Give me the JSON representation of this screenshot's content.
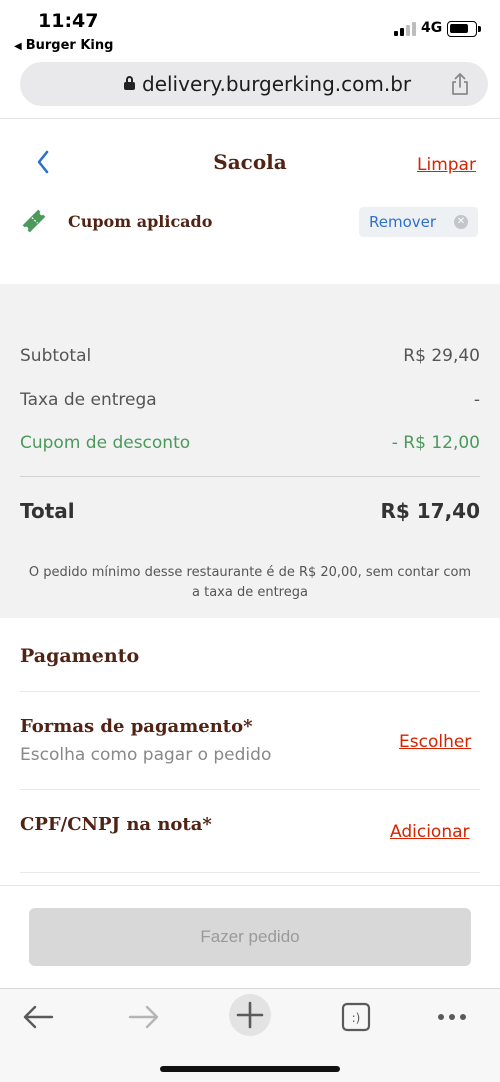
{
  "status": {
    "time": "11:47",
    "back_app": "Burger King",
    "network": "4G"
  },
  "browser": {
    "url": "delivery.burgerking.com.br"
  },
  "header": {
    "title": "Sacola",
    "clear_label": "Limpar"
  },
  "coupon": {
    "label": "Cupom aplicado",
    "remove_label": "Remover"
  },
  "summary": {
    "subtotal_label": "Subtotal",
    "subtotal_value": "R$ 29,40",
    "delivery_label": "Taxa de entrega",
    "delivery_value": "-",
    "discount_label": "Cupom de desconto",
    "discount_value": "- R$ 12,00",
    "total_label": "Total",
    "total_value": "R$ 17,40",
    "min_note": "O pedido mínimo desse restaurante é de R$ 20,00, sem contar com a taxa de entrega"
  },
  "payment": {
    "section_title": "Pagamento",
    "methods_title": "Formas de pagamento*",
    "methods_sub": "Escolha como pagar o pedido",
    "methods_action": "Escolher",
    "cpf_title": "CPF/CNPJ na nota*",
    "cpf_action": "Adicionar"
  },
  "order_button": "Fazer pedido",
  "colors": {
    "brand_brown": "#502314",
    "brand_red": "#d62300",
    "discount_green": "#4a9a5b",
    "link_blue": "#2e6fd0"
  },
  "icons": {
    "back": "chevron-left-icon",
    "coupon": "ticket-icon",
    "remove": "close-circle-icon",
    "share": "share-icon",
    "lock": "lock-icon",
    "toolbar": [
      "arrow-left-icon",
      "arrow-right-icon",
      "plus-icon",
      "tabs-icon",
      "more-icon"
    ]
  }
}
